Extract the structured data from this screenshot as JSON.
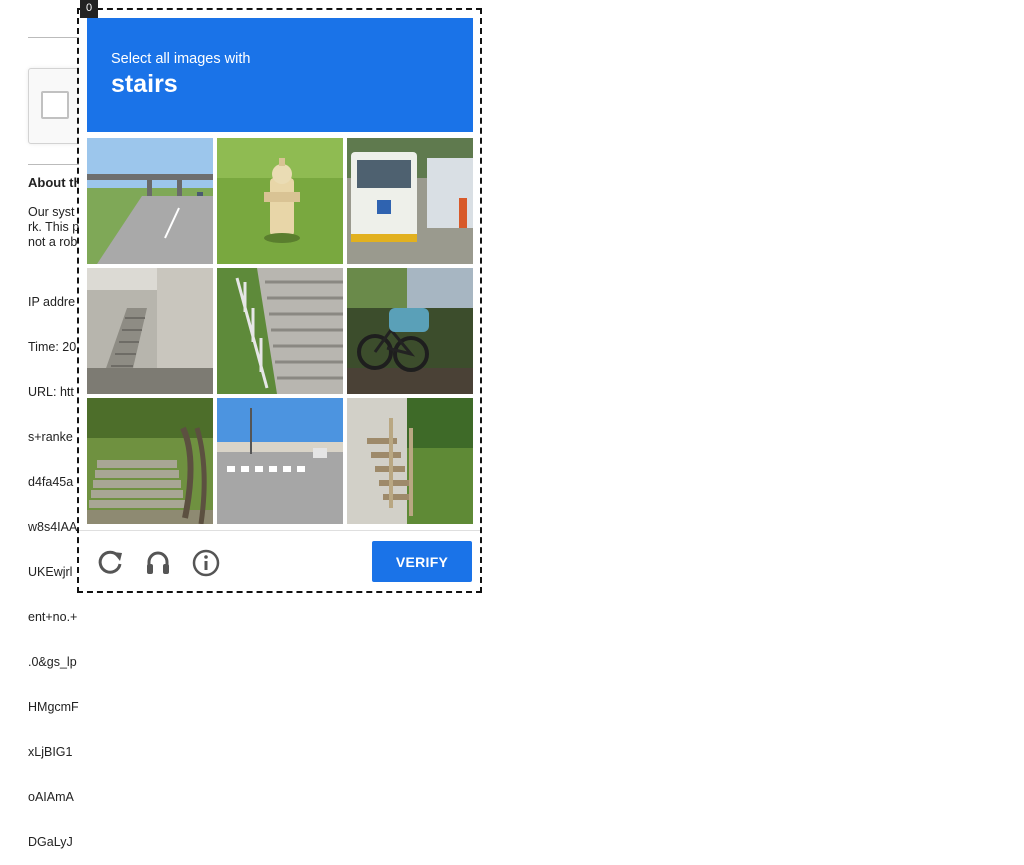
{
  "page": {
    "about_title": "About th",
    "paragraph_lines": [
      "Our syst",
      "rk. This p",
      "not a rob"
    ],
    "details_lines": [
      "IP addre",
      "Time: 20",
      "URL: htt",
      "s+ranke",
      "d4fa45a",
      "w8s4IAA",
      "UKEwjrl",
      "ent+no.+",
      ".0&gs_lp",
      "HMgcmF",
      "xLjBIG1",
      "oAIAmA",
      "DGaLyJ"
    ]
  },
  "captcha": {
    "challenge_id": "0",
    "prompt_small": "Select all images with",
    "prompt_target": "stairs",
    "tiles": [
      {
        "scene": "highway-overpass",
        "row": 1,
        "col": 1
      },
      {
        "scene": "fire-hydrant",
        "row": 1,
        "col": 2
      },
      {
        "scene": "bus",
        "row": 1,
        "col": 3
      },
      {
        "scene": "concrete-stairs",
        "row": 2,
        "col": 1
      },
      {
        "scene": "outdoor-stairs-railing",
        "row": 2,
        "col": 2
      },
      {
        "scene": "bicycle",
        "row": 2,
        "col": 3
      },
      {
        "scene": "park-stairs",
        "row": 3,
        "col": 1
      },
      {
        "scene": "crosswalk-road",
        "row": 3,
        "col": 2
      },
      {
        "scene": "wooden-stairs",
        "row": 3,
        "col": 3
      }
    ],
    "footer": {
      "reload_icon": "reload-icon",
      "audio_icon": "headphones-icon",
      "info_icon": "info-icon",
      "verify_label": "VERIFY"
    },
    "colors": {
      "accent": "#1a73e8"
    }
  }
}
